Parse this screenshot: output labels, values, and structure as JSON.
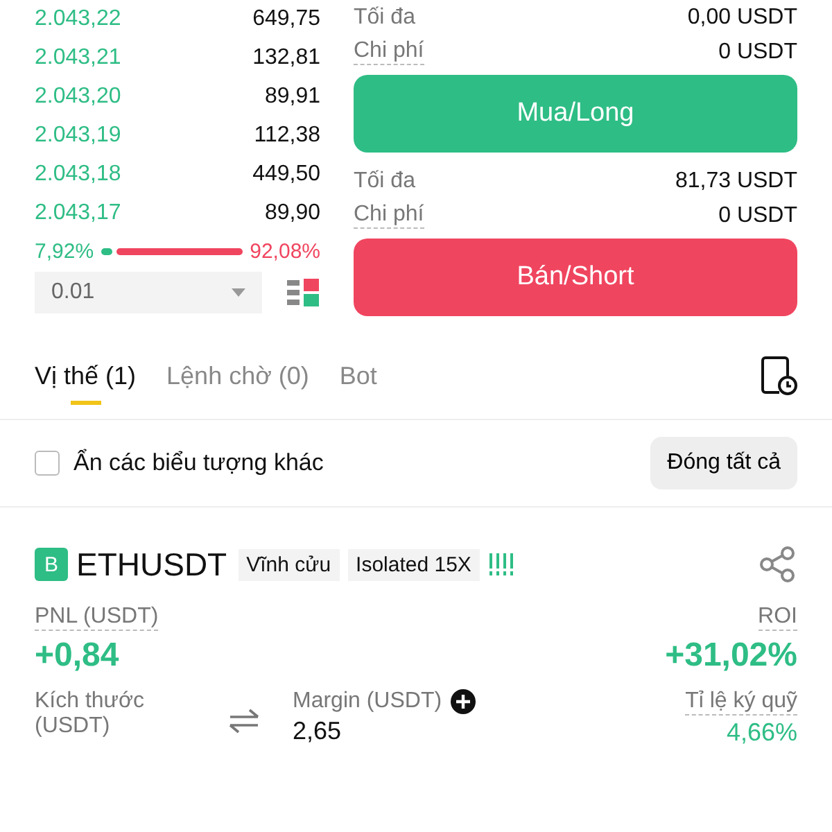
{
  "order_book": {
    "rows": [
      {
        "price": "2.043,22",
        "amount": "649,75"
      },
      {
        "price": "2.043,21",
        "amount": "132,81"
      },
      {
        "price": "2.043,20",
        "amount": "89,91"
      },
      {
        "price": "2.043,19",
        "amount": "112,38"
      },
      {
        "price": "2.043,18",
        "amount": "449,50"
      },
      {
        "price": "2.043,17",
        "amount": "89,90"
      }
    ],
    "buy_ratio": "7,92%",
    "sell_ratio": "92,08%",
    "level": 0.0792,
    "precision": "0.01"
  },
  "order_panel": [
    {
      "kind": "long",
      "max_label": "Tối đa",
      "max_value": "0,00 USDT",
      "fee_label": "Chi phí",
      "fee_value": "0 USDT",
      "button": "Mua/Long"
    },
    {
      "kind": "short",
      "max_label": "Tối đa",
      "max_value": "81,73 USDT",
      "fee_label": "Chi phí",
      "fee_value": "0 USDT",
      "button": "Bán/Short"
    }
  ],
  "tabs": [
    {
      "label": "Vị thế (1)",
      "selected": true
    },
    {
      "label": "Lệnh chờ (0)",
      "selected": false
    },
    {
      "label": "Bot",
      "selected": false
    }
  ],
  "hide_others": {
    "label": "Ẩn các biểu tượng khác",
    "checked": false
  },
  "close_all": "Đóng tất cả",
  "position": {
    "badge": "B",
    "symbol": "ETHUSDT",
    "tags": [
      "Vĩnh cửu",
      "Isolated 15X"
    ],
    "pnl_label": "PNL (USDT)",
    "pnl": "+0,84",
    "roi_label": "ROI",
    "roi": "+31,02%",
    "stats": [
      {
        "label": "Kích thước (USDT)"
      },
      {
        "label": "Margin (USDT)",
        "value": "2,65"
      },
      {
        "label": "Tỉ lệ ký quỹ",
        "value": "4,66%"
      }
    ]
  }
}
